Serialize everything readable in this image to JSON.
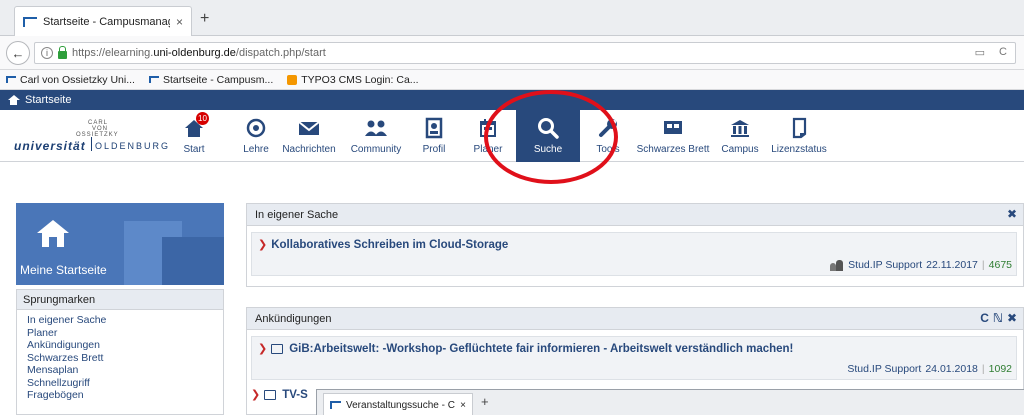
{
  "browser": {
    "tab_title": "Startseite - Campusmanag...",
    "tab_close": "×",
    "new_tab": "+",
    "back": "←",
    "info": "i",
    "url_prefix": "https://elearning.",
    "url_domain": "uni-oldenburg.de",
    "url_path": "/dispatch.php/start",
    "reader_icon": "▭",
    "reload": "C"
  },
  "bookmarks": [
    {
      "label": "Carl von Ossietzky Uni..."
    },
    {
      "label": "Startseite - Campusm..."
    },
    {
      "label": "TYPO3 CMS Login: Ca..."
    }
  ],
  "header": {
    "title": "Startseite"
  },
  "logo": {
    "small_line1": "CARL",
    "small_line2": "VON",
    "small_line3": "OSSIETZKY",
    "uni": "universität",
    "city": "OLDENBURG"
  },
  "nav": {
    "start_badge": "10",
    "items": [
      {
        "label": "Start"
      },
      {
        "label": "Lehre"
      },
      {
        "label": "Nachrichten"
      },
      {
        "label": "Community"
      },
      {
        "label": "Profil"
      },
      {
        "label": "Planer"
      },
      {
        "label": "Suche"
      },
      {
        "label": "Tools"
      },
      {
        "label": "Schwarzes Brett"
      },
      {
        "label": "Campus"
      },
      {
        "label": "Lizenzstatus"
      }
    ]
  },
  "sidebar": {
    "hero_title": "Meine Startseite",
    "jump_title": "Sprungmarken",
    "jump_items": [
      "In eigener Sache",
      "Planer",
      "Ankündigungen",
      "Schwarzes Brett",
      "Mensaplan",
      "Schnellzugriff",
      "Fragebögen"
    ]
  },
  "panels": {
    "own": {
      "title": "In eigener Sache",
      "close": "✖",
      "entry_title": "Kollaboratives Schreiben im Cloud-Storage",
      "author": "Stud.IP Support",
      "date": "22.11.2017",
      "sep": "|",
      "views": "4675"
    },
    "news": {
      "title": "Ankündigungen",
      "refresh": "C",
      "rss": "ℕ",
      "close": "✖",
      "entry1_title": "GiB:Arbeitswelt: -Workshop- Geflüchtete fair informieren - Arbeitswelt verständlich machen!",
      "author": "Stud.IP Support",
      "date": "24.01.2018",
      "sep": "|",
      "views": "1092",
      "entry2_title": "TV-S"
    }
  },
  "window2": {
    "tab_title": "Veranstaltungssuche - Ca...",
    "tab_close": "×",
    "new_tab": "+"
  },
  "colors": {
    "brand_blue": "#28497c",
    "annotation_red": "#e0101a",
    "badge_red": "#d60000"
  }
}
